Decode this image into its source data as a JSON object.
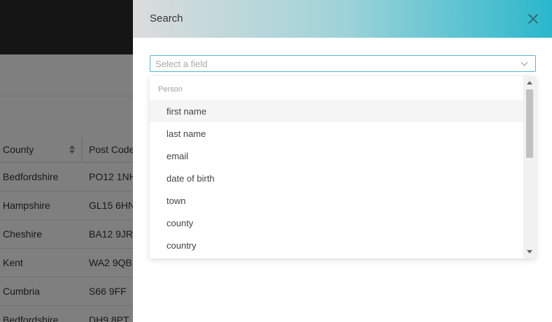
{
  "background_table": {
    "columns": [
      "County",
      "Post Code"
    ],
    "rows": [
      [
        "Bedfordshire",
        "PO12 1NH"
      ],
      [
        "Hampshire",
        "GL15 6HN"
      ],
      [
        "Cheshire",
        "BA12 9JR"
      ],
      [
        "Kent",
        "WA2 9QB"
      ],
      [
        "Cumbria",
        "S66 9FF"
      ],
      [
        "Bedfordshire",
        "DH9 8PT"
      ]
    ]
  },
  "search_panel": {
    "title": "Search",
    "close_icon": "close-icon",
    "field_select": {
      "placeholder": "Select a field",
      "value": ""
    },
    "dropdown": {
      "group_label": "Person",
      "options": [
        "first name",
        "last name",
        "email",
        "date of birth",
        "town",
        "county",
        "country"
      ],
      "hovered_index": 0
    }
  },
  "colors": {
    "header_gradient_end": "#2ab7cc",
    "select_border": "#55b6d3",
    "topbar": "#2b2b2b"
  }
}
